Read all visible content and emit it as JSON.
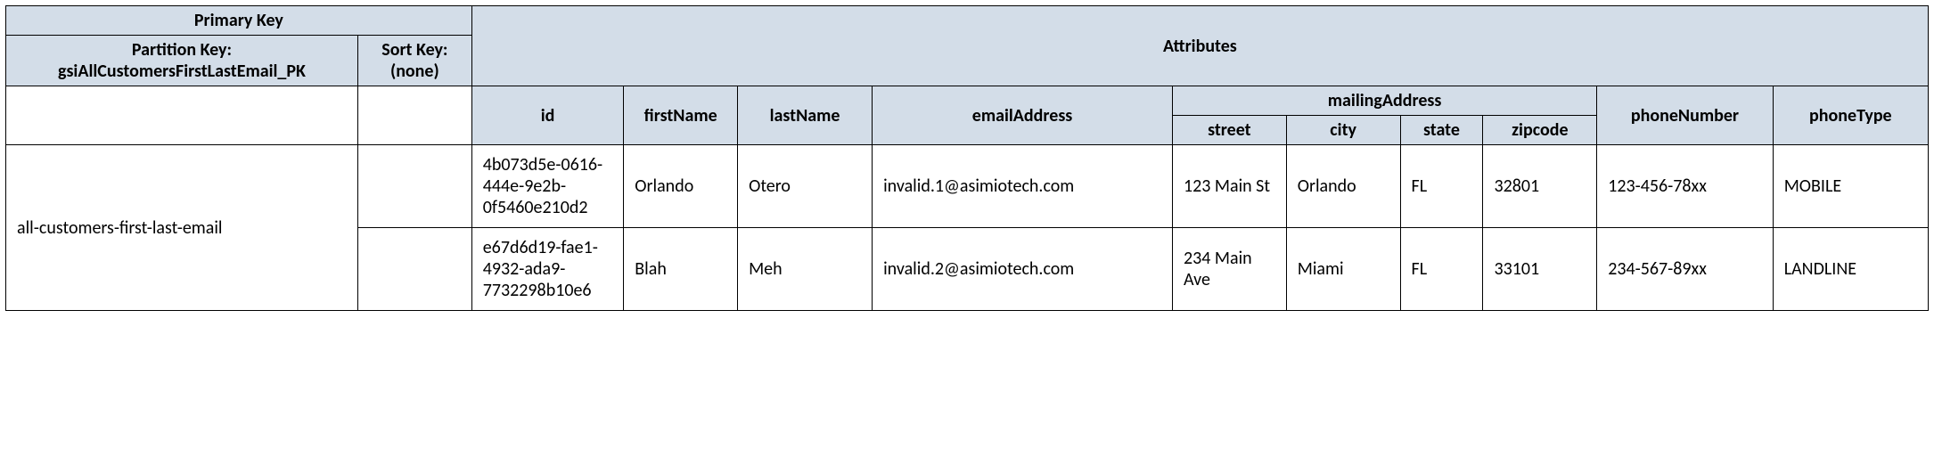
{
  "header": {
    "primaryKey": "Primary Key",
    "attributes": "Attributes",
    "partitionKey": "Partition Key: gsiAllCustomersFirstLastEmail_PK",
    "sortKey": "Sort Key: (none)"
  },
  "columns": {
    "id": "id",
    "firstName": "firstName",
    "lastName": "lastName",
    "emailAddress": "emailAddress",
    "mailingAddress": "mailingAddress",
    "street": "street",
    "city": "city",
    "state": "state",
    "zipcode": "zipcode",
    "phoneNumber": "phoneNumber",
    "phoneType": "phoneType"
  },
  "partitionValue": "all-customers-first-last-email",
  "rows": [
    {
      "id": "4b073d5e-0616-444e-9e2b-0f5460e210d2",
      "firstName": "Orlando",
      "lastName": "Otero",
      "emailAddress": "invalid.1@asimiotech.com",
      "street": "123 Main St",
      "city": "Orlando",
      "state": "FL",
      "zipcode": "32801",
      "phoneNumber": "123-456-78xx",
      "phoneType": "MOBILE"
    },
    {
      "id": "e67d6d19-fae1-4932-ada9-7732298b10e6",
      "firstName": "Blah",
      "lastName": "Meh",
      "emailAddress": "invalid.2@asimiotech.com",
      "street": "234 Main Ave",
      "city": "Miami",
      "state": "FL",
      "zipcode": "33101",
      "phoneNumber": "234-567-89xx",
      "phoneType": "LANDLINE"
    }
  ]
}
